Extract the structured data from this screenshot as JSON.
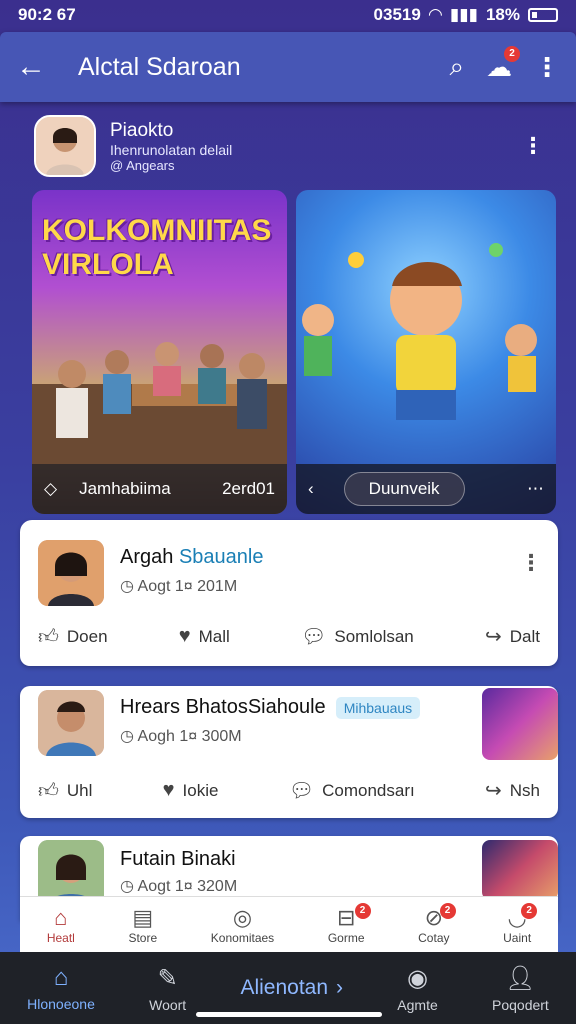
{
  "status_bar": {
    "time": "90:2 67",
    "right_text": "03519",
    "battery": "18%"
  },
  "app_bar": {
    "title": "Alctal Sdaroan",
    "notif_count": "2"
  },
  "profile": {
    "name": "Piaokto",
    "description": "Ihenrunolatan delail",
    "subtitle": "@ Angears"
  },
  "media": {
    "poster_title": "KOLKOMNIITAS VIRLOLA",
    "left_caption": "Jamhabiima",
    "left_count": "2erd01",
    "right_button": "Duunveik"
  },
  "posts": [
    {
      "name": "Argah",
      "name_highlight": "Sbauanle",
      "time": "Aogt 1¤ 201M",
      "actions": [
        "Doen",
        "Mall",
        "Somlolsan",
        "Dalt"
      ]
    },
    {
      "name": "Hrears BhatosSiahoule",
      "tag": "Mihbauaus",
      "time": "Aogh 1¤ 300M",
      "actions": [
        "Uhl",
        "Iokie",
        "Comondsarı",
        "Nsh"
      ]
    },
    {
      "name": "Futain Binaki",
      "time": "Aogt 1¤ 320M"
    }
  ],
  "tabs": [
    {
      "label": "Heatl",
      "icon": "home-icon",
      "badge": ""
    },
    {
      "label": "Store",
      "icon": "store-icon",
      "badge": ""
    },
    {
      "label": "Konomitaes",
      "icon": "chat-icon",
      "badge": ""
    },
    {
      "label": "Gorme",
      "icon": "game-icon",
      "badge": "2"
    },
    {
      "label": "Cotay",
      "icon": "gift-icon",
      "badge": "2"
    },
    {
      "label": "Uaint",
      "icon": "user-icon",
      "badge": "2"
    }
  ],
  "bottom_nav": {
    "home": "Hlonoeone",
    "woot": "Woort",
    "center": "Alienotan",
    "agmte": "Agmte",
    "peopleon": "Poqodert"
  },
  "colors": {
    "app_bar": "#4756b5",
    "accent_badge": "#e53935",
    "link_blue": "#1a7fb5"
  }
}
